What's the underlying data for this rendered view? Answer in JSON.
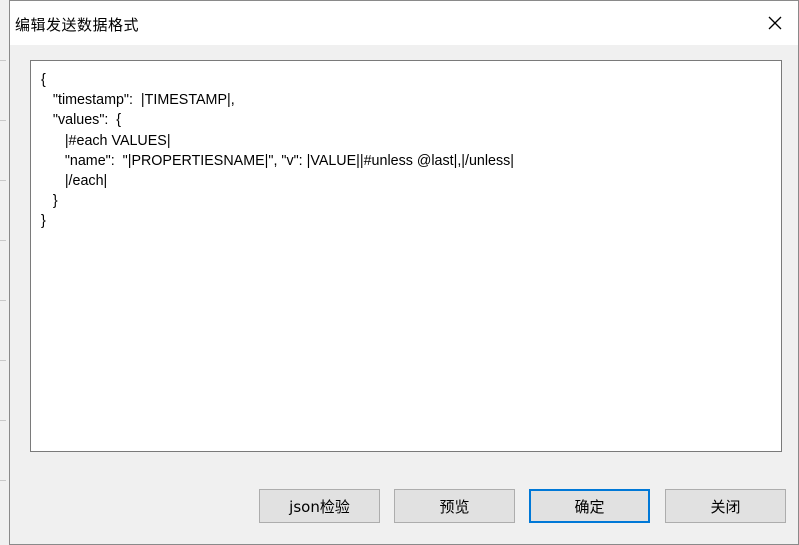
{
  "window": {
    "title": "编辑发送数据格式",
    "close_icon": "close-icon"
  },
  "editor": {
    "lines": [
      "{",
      "   \"timestamp\":  |TIMESTAMP|,",
      "   \"values\":  {",
      "      |#each VALUES|",
      "      \"name\":  \"|PROPERTIESNAME|\", \"v\": |VALUE||#unless @last|,|/unless|",
      "      |/each|",
      "   }",
      "}"
    ]
  },
  "buttons": {
    "json_check": "json检验",
    "preview": "预览",
    "ok": "确定",
    "close": "关闭"
  },
  "colors": {
    "dialog_bg": "#f0f0f0",
    "button_bg": "#e1e1e1",
    "focus_border": "#0078d7"
  }
}
